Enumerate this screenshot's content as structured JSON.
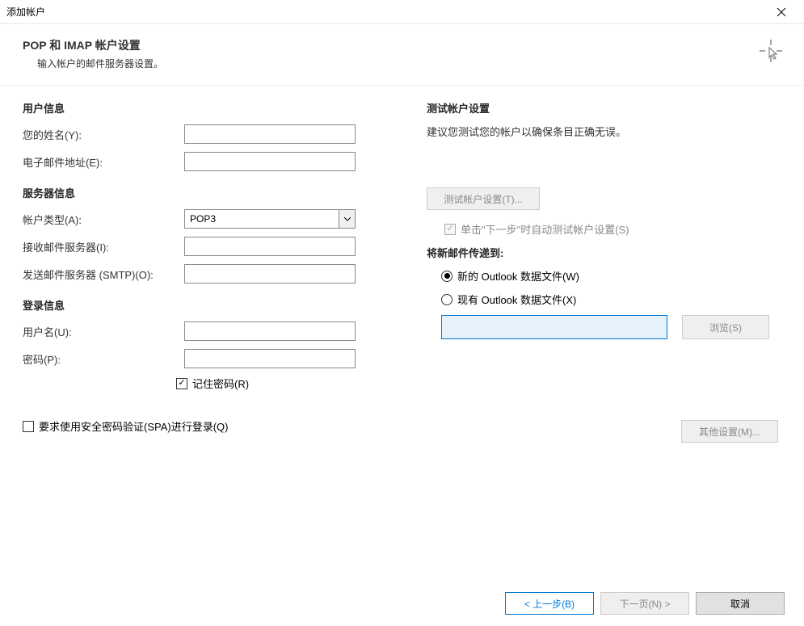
{
  "window": {
    "title": "添加帐户"
  },
  "header": {
    "title": "POP 和 IMAP 帐户设置",
    "subtitle": "输入帐户的邮件服务器设置。"
  },
  "left": {
    "user_info_title": "用户信息",
    "name_label": "您的姓名(Y):",
    "name_value": "",
    "email_label": "电子邮件地址(E):",
    "email_value": "",
    "server_info_title": "服务器信息",
    "account_type_label": "帐户类型(A):",
    "account_type_value": "POP3",
    "incoming_label": "接收邮件服务器(I):",
    "incoming_value": "",
    "outgoing_label": "发送邮件服务器 (SMTP)(O):",
    "outgoing_value": "",
    "login_info_title": "登录信息",
    "username_label": "用户名(U):",
    "username_value": "",
    "password_label": "密码(P):",
    "password_value": "",
    "remember_password_label": "记住密码(R)",
    "spa_label": "要求使用安全密码验证(SPA)进行登录(Q)"
  },
  "right": {
    "test_title": "测试帐户设置",
    "test_desc": "建议您测试您的帐户以确保条目正确无误。",
    "test_btn": "测试帐户设置(T)...",
    "auto_test_label": "单击\"下一步\"时自动测试帐户设置(S)",
    "deliver_title": "将新邮件传递到:",
    "radio_new": "新的 Outlook 数据文件(W)",
    "radio_existing": "现有 Outlook 数据文件(X)",
    "browse_btn": "浏览(S)",
    "other_settings_btn": "其他设置(M)..."
  },
  "footer": {
    "back": "< 上一步(B)",
    "next": "下一页(N) >",
    "cancel": "取消"
  }
}
